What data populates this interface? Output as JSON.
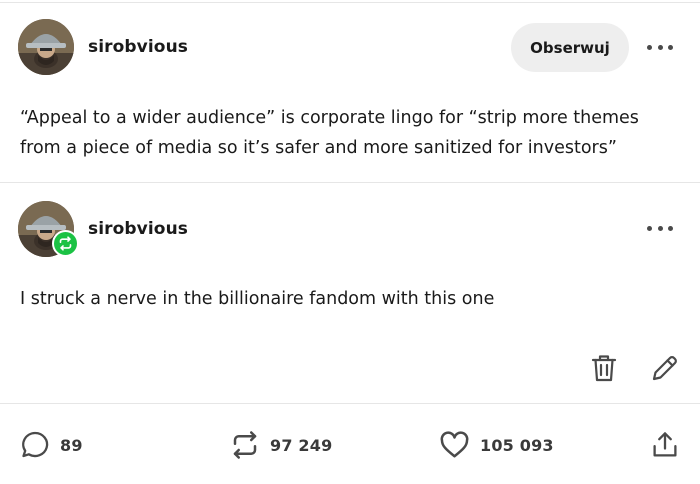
{
  "post": {
    "author": "sirobvious",
    "follow_label": "Obserwuj",
    "text": "“Appeal to a wider audience” is corporate lingo for “strip more themes from a piece of media so it’s safer and more sanitized for investors”"
  },
  "reblog": {
    "author": "sirobvious",
    "text": "I struck a nerve in the billionaire fandom with this one"
  },
  "footer": {
    "comments": "89",
    "reblogs": "97 249",
    "likes": "105 093"
  },
  "icons": {
    "more": "more-horizontal-icon",
    "reblog_badge": "reblog-badge-icon",
    "delete": "trash-icon",
    "edit": "pencil-icon",
    "comment": "comment-icon",
    "reblog": "reblog-icon",
    "like": "heart-icon",
    "share": "share-icon"
  },
  "colors": {
    "badge_green": "#1bc244",
    "button_bg": "#eeeeee",
    "icon_gray": "#4a4a4a"
  }
}
